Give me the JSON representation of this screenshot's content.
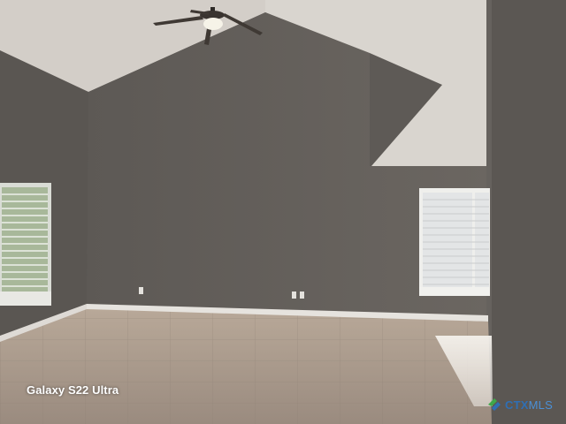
{
  "photo": {
    "caption": "Galaxy S22 Ultra",
    "logo": {
      "brand": "CTX",
      "suffix": "MLS",
      "mark_colors": [
        "#3fa84a",
        "#2f6fb4"
      ]
    }
  },
  "palette": {
    "wall": "#65605c",
    "ceiling": "#d9d5cf",
    "floor": "#a6978a",
    "baseboard": "#e8e6e1",
    "window": "#e6e8ea"
  }
}
